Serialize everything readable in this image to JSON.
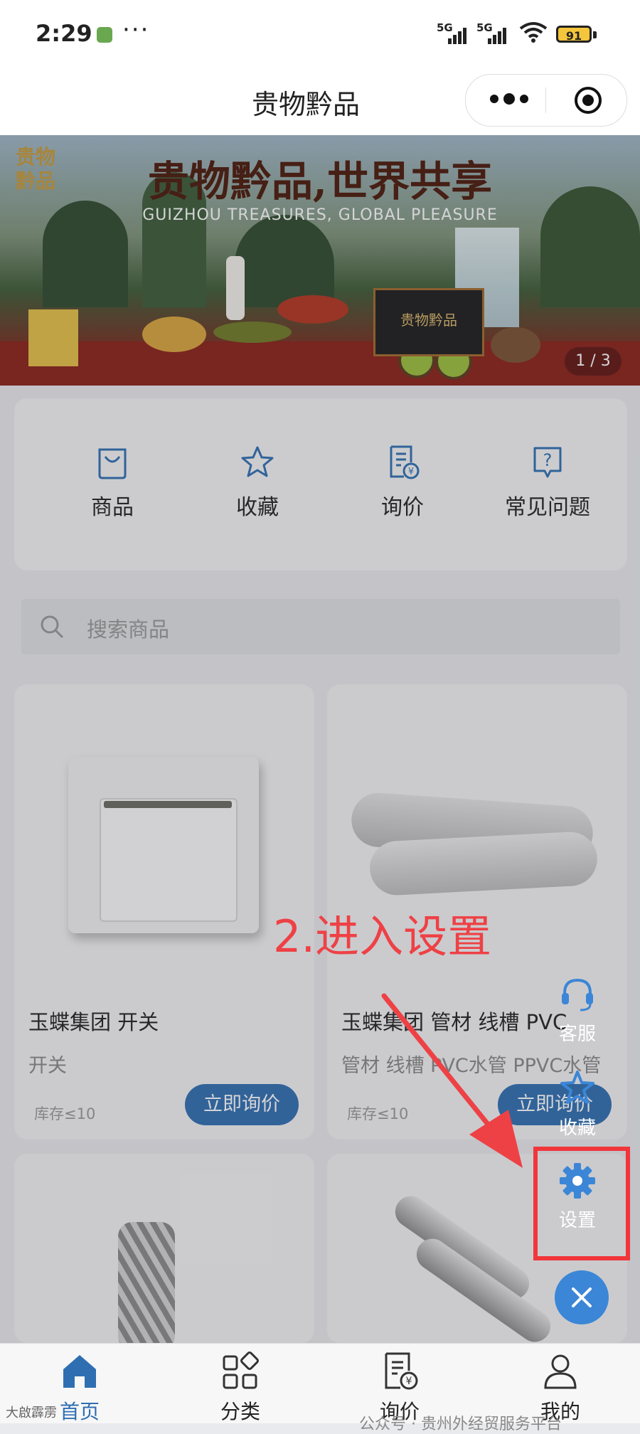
{
  "status_bar": {
    "time": "2:29",
    "network1": "5G",
    "network2": "5G",
    "battery": "91"
  },
  "navbar": {
    "title": "贵物黔品"
  },
  "banner": {
    "headline": "贵物黔品,世界共享",
    "subtitle": "GUIZHOU TREASURES, GLOBAL PLEASURE",
    "logo_text": "贵物黔品",
    "box_text": "贵物黔品",
    "pager": "1 / 3"
  },
  "quick_nav": [
    {
      "label": "商品",
      "icon": "shopping-bag-icon"
    },
    {
      "label": "收藏",
      "icon": "star-icon"
    },
    {
      "label": "询价",
      "icon": "quote-document-icon"
    },
    {
      "label": "常见问题",
      "icon": "question-icon"
    }
  ],
  "search": {
    "placeholder": "搜索商品"
  },
  "products": [
    {
      "name": "玉蝶集团 开关",
      "tag": "开关",
      "stock": "库存≤10",
      "button": "立即询价"
    },
    {
      "name": "玉蝶集团 管材 线槽 PVC",
      "tag": "管材 线槽 PVC水管 PPVC水管",
      "stock": "库存≤10",
      "button": "立即询价"
    }
  ],
  "floating_menu": {
    "service": "客服",
    "favorites": "收藏",
    "settings": "设置"
  },
  "annotation": "2.进入设置",
  "tab_bar": [
    {
      "label": "首页",
      "icon": "home-icon",
      "active": true
    },
    {
      "label": "分类",
      "icon": "category-icon",
      "active": false
    },
    {
      "label": "询价",
      "icon": "quote-icon",
      "active": false
    },
    {
      "label": "我的",
      "icon": "user-icon",
      "active": false
    }
  ],
  "watermark": "公众号 · 贵州外经贸服务平台",
  "watermark_corner": "大啟霹雳",
  "colors": {
    "accent": "#2f6fb1",
    "annotation": "#ee4145",
    "fab": "#3b86d6"
  }
}
